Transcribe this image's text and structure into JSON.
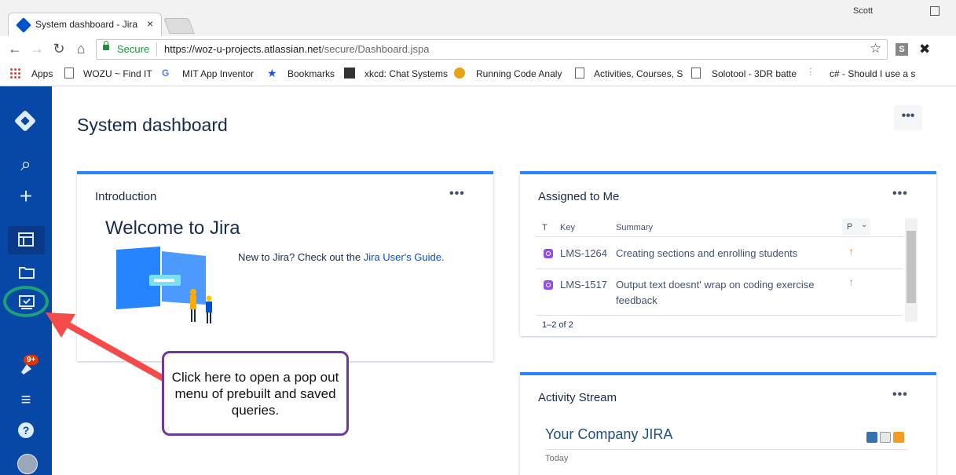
{
  "browser": {
    "tab_title": "System dashboard - Jira",
    "tab_close": "×",
    "user": "Scott",
    "secure_label": "Secure",
    "url_host": "https://woz-u-projects.atlassian.net",
    "url_path": "/secure/Dashboard.jspa",
    "nav": {
      "back": "←",
      "forward": "→",
      "reload": "↻",
      "home": "⌂",
      "star": "☆"
    },
    "ext_label": "S",
    "ext2_glyph": "✖",
    "bookmarks": [
      "Apps",
      "WOZU ~ Find IT",
      "MIT App Inventor",
      "Bookmarks",
      "xkcd: Chat Systems",
      "Running Code Analy",
      "Activities, Courses, S",
      "Solotool - 3DR batte",
      "c# - Should I use a s"
    ]
  },
  "sidebar": {
    "icons": [
      "jira-logo",
      "search-icon",
      "plus-icon",
      "dashboard-icon",
      "folder-icon",
      "queries-icon",
      "notification-icon",
      "menu-icon",
      "help-icon",
      "avatar"
    ],
    "search_glyph": "⌕",
    "plus_glyph": "+",
    "menu_glyph": "≡",
    "help_glyph": "?",
    "notification_badge": "9+"
  },
  "dashboard": {
    "title": "System dashboard",
    "more": "•••"
  },
  "introduction": {
    "title": "Introduction",
    "more": "•••",
    "welcome": "Welcome to Jira",
    "text_before": "New to Jira? Check out the ",
    "link": "Jira User's Guide",
    "text_after": "."
  },
  "assigned": {
    "title": "Assigned to Me",
    "more": "•••",
    "columns": {
      "type": "T",
      "key": "Key",
      "summary": "Summary",
      "priority": "P"
    },
    "rows": [
      {
        "key": "LMS-1264",
        "summary": "Creating sections and enrolling students",
        "priority": "↑"
      },
      {
        "key": "LMS-1517",
        "summary_line1": "Output text doesnt' wrap on coding exercise",
        "summary_line2": "feedback",
        "priority": "↑"
      }
    ],
    "pager": "1–2 of 2"
  },
  "activity": {
    "title": "Activity Stream",
    "more": "•••",
    "company": "Your Company JIRA",
    "today": "Today"
  },
  "annotation": {
    "callout": "Click here to open a pop out menu of prebuilt and saved queries."
  }
}
